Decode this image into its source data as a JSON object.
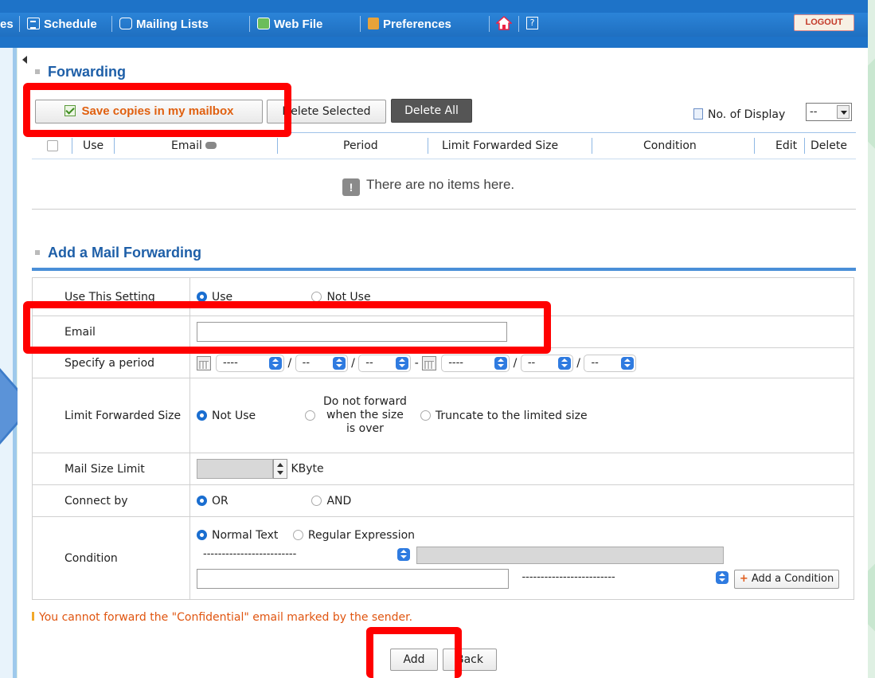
{
  "nav": {
    "items": [
      {
        "label": "es",
        "icon": ""
      },
      {
        "label": "Schedule",
        "icon": "calendar-icon"
      },
      {
        "label": "Mailing Lists",
        "icon": "mailing-list-icon"
      },
      {
        "label": "Web File",
        "icon": "web-file-icon"
      },
      {
        "label": "Preferences",
        "icon": "preferences-icon"
      }
    ],
    "help": "?",
    "logout": "LOGOUT"
  },
  "forwarding": {
    "title": "Forwarding",
    "save_copies": "Save copies in my mailbox",
    "delete_selected": "Delete Selected",
    "delete_all": "Delete All",
    "display_label": "No. of Display",
    "display_value": "--",
    "columns": [
      "Use",
      "Email",
      "Period",
      "Limit Forwarded Size",
      "Condition",
      "Edit",
      "Delete"
    ],
    "empty": "There are no items here."
  },
  "add": {
    "title": "Add a Mail Forwarding",
    "use_setting": {
      "label": "Use This Setting",
      "options": [
        "Use",
        "Not Use"
      ],
      "selected": "Use"
    },
    "email": {
      "label": "Email",
      "value": ""
    },
    "period": {
      "label": "Specify a period",
      "year": "----",
      "month": "--",
      "day": "--",
      "sep": "/",
      "dash": "-"
    },
    "limit_size": {
      "label": "Limit Forwarded Size",
      "options": [
        "Not Use",
        "Do not forward when the size is over",
        "Truncate to the limited size"
      ],
      "selected": "Not Use"
    },
    "size_limit": {
      "label": "Mail Size Limit",
      "value": "",
      "unit": "KByte"
    },
    "connect": {
      "label": "Connect by",
      "options": [
        "OR",
        "AND"
      ],
      "selected": "OR"
    },
    "condition": {
      "label": "Condition",
      "options": [
        "Normal Text",
        "Regular Expression"
      ],
      "selected": "Normal Text",
      "field_select": "-------------------------",
      "op_select": "-------------------------",
      "add_label": "Add a Condition"
    },
    "warning": "You cannot forward the \"Confidential\" email marked by the sender.",
    "add_button": "Add",
    "back_button": "Back"
  }
}
